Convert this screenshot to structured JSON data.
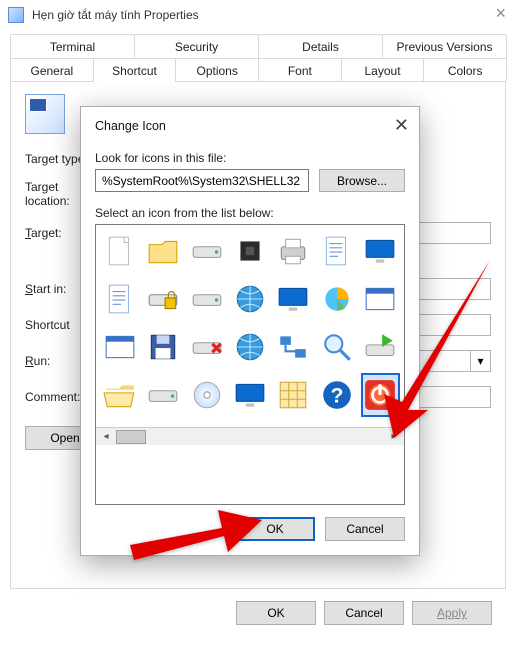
{
  "properties": {
    "title": "Hẹn giờ tắt máy tính Properties",
    "tabs_row1": [
      "Terminal",
      "Security",
      "Details",
      "Previous Versions"
    ],
    "tabs_row2": [
      "General",
      "Shortcut",
      "Options",
      "Font",
      "Layout",
      "Colors"
    ],
    "active_tab": "Shortcut",
    "fields": {
      "target_type": "Target type:",
      "target_location": "Target location:",
      "target": "Target:",
      "start_in": "Start in:",
      "shortcut_key": "Shortcut",
      "run": "Run:",
      "comment": "Comment:"
    },
    "open_file_location": "Open",
    "more": "...",
    "buttons": {
      "ok": "OK",
      "cancel": "Cancel",
      "apply": "Apply"
    }
  },
  "modal": {
    "title": "Change Icon",
    "look_label": "Look for icons in this file:",
    "path": "%SystemRoot%\\System32\\SHELL32",
    "browse": "Browse...",
    "select_label": "Select an icon from the list below:",
    "buttons": {
      "ok": "OK",
      "cancel": "Cancel"
    },
    "icons": [
      [
        "blank-page",
        "folder",
        "drive",
        "chip",
        "printer",
        "document",
        "monitor-wide"
      ],
      [
        "text-page",
        "disk-lock",
        "drive2",
        "globe",
        "monitor-blue",
        "pie-chart",
        "window-app"
      ],
      [
        "window",
        "floppy",
        "drive-x",
        "globe-net",
        "network",
        "magnifier",
        "drive-green"
      ],
      [
        "folder-open",
        "drive-flat",
        "cd",
        "monitor",
        "grid",
        "help",
        "power"
      ]
    ],
    "selected": "power"
  }
}
